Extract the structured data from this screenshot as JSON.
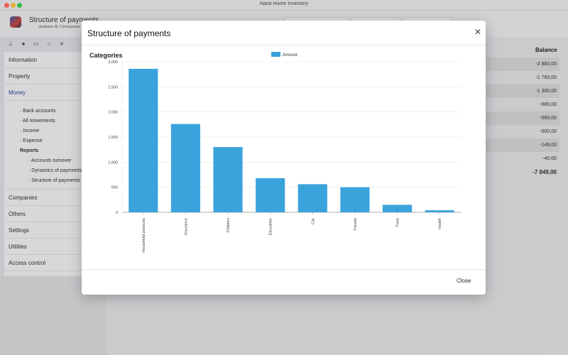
{
  "window": {
    "title": "Nano Home Inventory"
  },
  "app": {
    "title": "Structure of payments",
    "subtitle": "database.db, Супердомен"
  },
  "sidebar": {
    "items_top": [
      "Information",
      "Property",
      "Money"
    ],
    "money_sub": [
      "· Bank accounts",
      "· All movements",
      "· Income",
      "· Expense"
    ],
    "reports_label": "Reports",
    "reports_sub": [
      "· Accounts turnover",
      "· Dynamics of payments",
      "· Structure of payments"
    ],
    "items_bottom": [
      "Companies",
      "Others",
      "Settings",
      "Utilities",
      "Access control"
    ]
  },
  "balance": {
    "header": "Balance",
    "rows": [
      "-2 860,00",
      "-1 760,00",
      "-1 300,00",
      "-680,00",
      "-560,00",
      "-500,00",
      "-149,00",
      "-40,00"
    ],
    "total": "-7 849,00"
  },
  "modal": {
    "title": "Structure of payments",
    "close_label": "Close"
  },
  "colors": {
    "bar": "#3aa3dc",
    "accent": "#1a3a8a"
  },
  "chart_data": {
    "type": "bar",
    "title": "Categories",
    "categories": [
      "Household products",
      "Insurance",
      "Children",
      "Education",
      "Car",
      "Travels",
      "Food",
      "Health"
    ],
    "series": [
      {
        "name": "Amount",
        "values": [
          2860,
          1760,
          1300,
          680,
          560,
          500,
          149,
          40
        ]
      }
    ],
    "ylim": [
      0,
      3000
    ],
    "yticks": [
      "0",
      "500",
      "1,000",
      "1,500",
      "2,000",
      "2,500",
      "3,000"
    ],
    "grid": true,
    "legend": "top-center"
  }
}
